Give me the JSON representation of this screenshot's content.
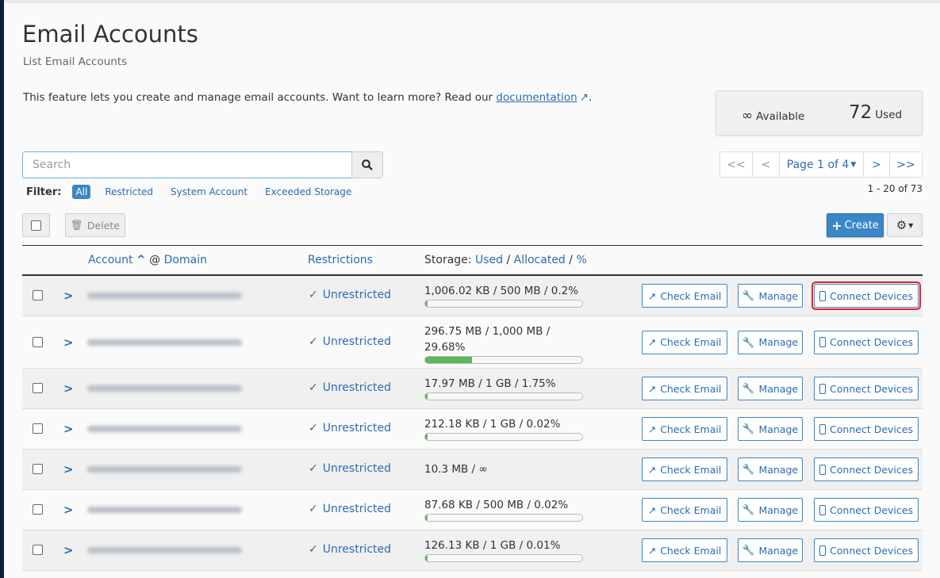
{
  "page": {
    "title": "Email Accounts",
    "subtitle": "List Email Accounts",
    "description": "This feature lets you create and manage email accounts. Want to learn more? Read our ",
    "doc_link": "documentation",
    "desc_end": "."
  },
  "stats": {
    "available_value": "∞",
    "available_label": "Available",
    "used_value": "72",
    "used_label": "Used"
  },
  "search": {
    "placeholder": "Search",
    "value": ""
  },
  "filter": {
    "label": "Filter:",
    "options": [
      "All",
      "Restricted",
      "System Account",
      "Exceeded Storage"
    ],
    "active": "All"
  },
  "pagination": {
    "first": "<<",
    "prev": "<",
    "page": "Page 1 of 4",
    "next": ">",
    "last": ">>",
    "range": "1 - 20 of 73"
  },
  "toolbar": {
    "delete": "Delete",
    "create": "Create"
  },
  "table": {
    "headers": {
      "account": "Account",
      "at": "@",
      "domain": "Domain",
      "restrictions": "Restrictions",
      "storage": "Storage:",
      "used": "Used",
      "allocated": "Allocated",
      "percent": "%",
      "sep": "/"
    },
    "rows": [
      {
        "restriction": "Unrestricted",
        "storage": "1,006.02 KB / 500 MB / 0.2%",
        "percent": 0.2
      },
      {
        "restriction": "Unrestricted",
        "storage": "296.75 MB / 1,000 MB / 29.68%",
        "percent": 29.68
      },
      {
        "restriction": "Unrestricted",
        "storage": "17.97 MB / 1 GB / 1.75%",
        "percent": 1.75
      },
      {
        "restriction": "Unrestricted",
        "storage": "212.18 KB / 1 GB / 0.02%",
        "percent": 0.02
      },
      {
        "restriction": "Unrestricted",
        "storage": "10.3 MB / ∞",
        "percent": null
      },
      {
        "restriction": "Unrestricted",
        "storage": "87.68 KB / 500 MB / 0.02%",
        "percent": 0.02
      },
      {
        "restriction": "Unrestricted",
        "storage": "126.13 KB / 1 GB / 0.01%",
        "percent": 0.01
      }
    ],
    "actions": {
      "check_email": "Check Email",
      "manage": "Manage",
      "connect_devices": "Connect Devices"
    }
  },
  "colors": {
    "accent": "#3a87c8",
    "link": "#2a6db0",
    "success": "#5cb85c",
    "highlight": "#e0252f"
  }
}
